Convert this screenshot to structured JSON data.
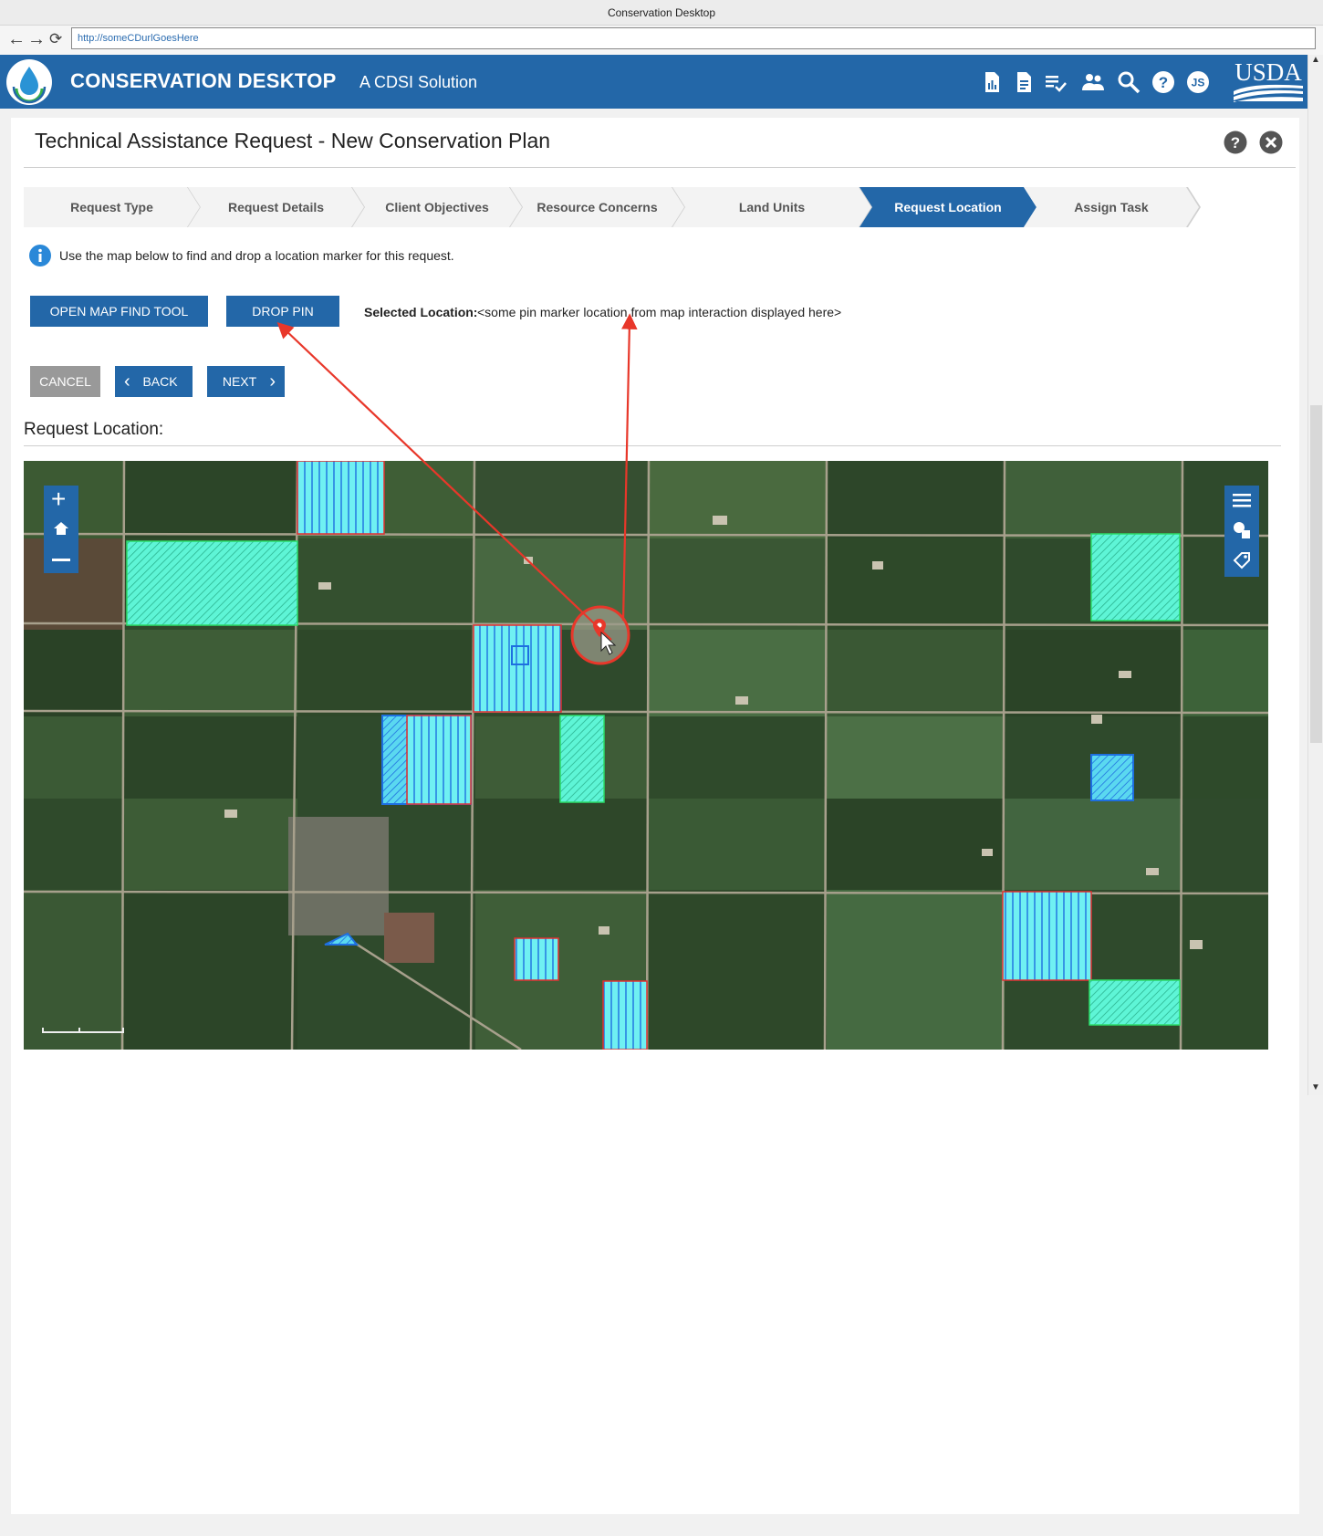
{
  "browser": {
    "window_title": "Conservation Desktop",
    "url": "http://someCDurlGoesHere"
  },
  "header": {
    "brand": "CONSERVATION DESKTOP",
    "tagline": "A CDSI Solution",
    "user_initials": "JS",
    "agency_logo": "USDA",
    "icons": [
      "report-icon",
      "document-icon",
      "checklist-icon",
      "people-icon",
      "search-icon",
      "help-icon",
      "user-avatar"
    ]
  },
  "page": {
    "title": "Technical Assistance Request - New Conservation Plan"
  },
  "stepper": {
    "steps": [
      {
        "label": "Request Type",
        "active": false
      },
      {
        "label": "Request Details",
        "active": false
      },
      {
        "label": "Client Objectives",
        "active": false
      },
      {
        "label": "Resource Concerns",
        "active": false
      },
      {
        "label": "Land Units",
        "active": false
      },
      {
        "label": "Request Location",
        "active": true
      },
      {
        "label": "Assign Task",
        "active": false
      }
    ]
  },
  "info": {
    "text": "Use the map below to find and drop a location marker for this request."
  },
  "actions": {
    "open_map_find_tool": "OPEN MAP FIND TOOL",
    "drop_pin": "DROP PIN",
    "selected_location_label": "Selected Location:",
    "selected_location_value": "<some pin marker location from map interaction displayed here>",
    "cancel": "CANCEL",
    "back": "BACK",
    "next": "NEXT"
  },
  "map": {
    "section_title": "Request Location:",
    "left_tools": [
      "zoom-in-icon",
      "home-icon",
      "zoom-out-icon"
    ],
    "right_tools": [
      "layers-icon",
      "shapes-icon",
      "tag-icon"
    ],
    "colors": {
      "field_fill": "#5ef5d6",
      "field_red_outline": "#e03030",
      "field_blue_outline": "#1e6fe0",
      "annotation": "#e8372a",
      "brand_blue": "#2367a8"
    }
  }
}
